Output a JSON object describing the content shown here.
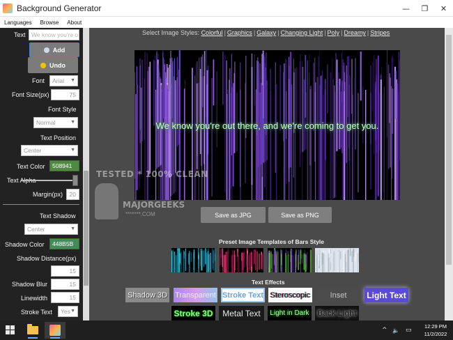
{
  "window": {
    "title": "Background Generator"
  },
  "window_controls": {
    "minimize": "—",
    "restore": "❐",
    "close": "✕"
  },
  "menu": [
    "Languages",
    "Browse",
    "About"
  ],
  "sidebar": {
    "text_label": "Text",
    "text_value": "We know you're o",
    "add_button": "Add",
    "undo_button": "Undo",
    "font_label": "Font",
    "font_value": "Arial",
    "font_size_label": "Font Size(px)",
    "font_size_value": "75",
    "font_style_label": "Font Style",
    "font_style_value": "Normal",
    "text_position_label": "Text Position",
    "text_position_value": "Center",
    "text_color_label": "Text Color",
    "text_color_value": "508941",
    "text_alpha_label": "Text Alpha",
    "margin_label": "Margin(px)",
    "margin_value": "20",
    "text_shadow_label": "Text Shadow",
    "shadow_position_value": "Center",
    "shadow_color_label": "Shadow Color",
    "shadow_color_value": "448B5B",
    "shadow_distance_label": "Shadow Distance(px)",
    "shadow_distance_value": "15",
    "shadow_blur_label": "Shadow Blur",
    "shadow_blur_value": "15",
    "linewidth_label": "Linewidth",
    "linewidth_value": "15",
    "stroke_text_label": "Stroke Text",
    "stroke_text_value": "Yes"
  },
  "style_bar": {
    "prefix": "Select Image Styles:",
    "links": [
      "Colorful",
      "Graphics",
      "Galaxy",
      "Changing Light",
      "Poly",
      "Dreamy",
      "Stripes"
    ]
  },
  "canvas": {
    "text": "We know you're out there, and we're coming to get you."
  },
  "watermark": {
    "line1": "TESTED * 100% CLEAN",
    "line2": "MAJORGEEKS",
    "line3": "*******.COM"
  },
  "save": {
    "jpg": "Save as JPG",
    "png": "Save as PNG"
  },
  "presets": {
    "title": "Preset Image Templates of Bars Style"
  },
  "effects": {
    "title": "Text Effects",
    "row1": [
      "Shadow 3D",
      "Transparent",
      "Stroke Text",
      "Steroscopic",
      "Inset",
      "Light Text"
    ],
    "row2": [
      "Stroke 3D",
      "Metal Text",
      "Light in Dark",
      "Back Light"
    ]
  },
  "taskbar": {
    "time": "12:29 PM",
    "date": "11/2/2022",
    "tray_chevron": "^",
    "tray_sound": "🔈",
    "tray_notify": "▭"
  },
  "colors": {
    "text_color": "#508941",
    "shadow_color": "#448B5B",
    "sidebar_bg": "#222222",
    "main_bg": "#4a4a4a"
  }
}
